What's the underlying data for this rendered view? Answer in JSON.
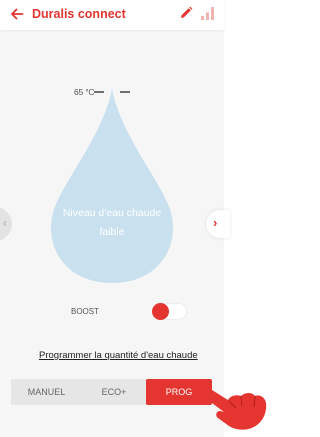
{
  "colors": {
    "accent": "#e43530",
    "drop": "#c9e0ee",
    "background": "#f6f6f6"
  },
  "header": {
    "back_icon": "arrow-left-icon",
    "title": "Duralis connect",
    "edit_icon": "pencil-icon",
    "signal_icon": "signal-bars-icon"
  },
  "tank": {
    "temperature": "65 °C",
    "status_label": "Niveau d'eau chaude faible",
    "nav_prev_glyph": "‹",
    "nav_next_glyph": "›"
  },
  "boost": {
    "label": "BOOST",
    "enabled": false
  },
  "program_link": "Programmer la quantité d'eau chaude",
  "modes": {
    "tabs": [
      "MANUEL",
      "ECO+",
      "PROG"
    ],
    "selected": "PROG"
  },
  "overlay": {
    "hand_icon": "pointing-hand-icon"
  }
}
